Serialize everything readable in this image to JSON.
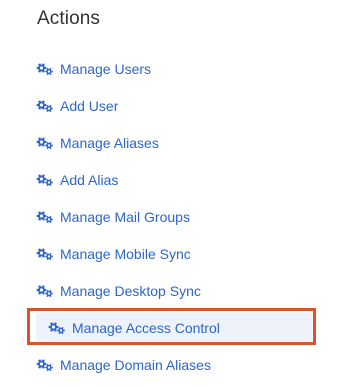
{
  "heading": "Actions",
  "selected_index": 7,
  "items": [
    {
      "label": "Manage Users",
      "icon": "gears-icon"
    },
    {
      "label": "Add User",
      "icon": "gears-icon"
    },
    {
      "label": "Manage Aliases",
      "icon": "gears-icon"
    },
    {
      "label": "Add Alias",
      "icon": "gears-icon"
    },
    {
      "label": "Manage Mail Groups",
      "icon": "gears-icon"
    },
    {
      "label": "Manage Mobile Sync",
      "icon": "gears-icon"
    },
    {
      "label": "Manage Desktop Sync",
      "icon": "gears-icon"
    },
    {
      "label": "Manage Access Control",
      "icon": "gears-icon"
    },
    {
      "label": "Manage Domain Aliases",
      "icon": "gears-icon"
    }
  ],
  "colors": {
    "link": "#2c66cc",
    "heading": "#333333",
    "highlight_border": "#d9542b",
    "highlight_bg": "#eef2fb"
  }
}
